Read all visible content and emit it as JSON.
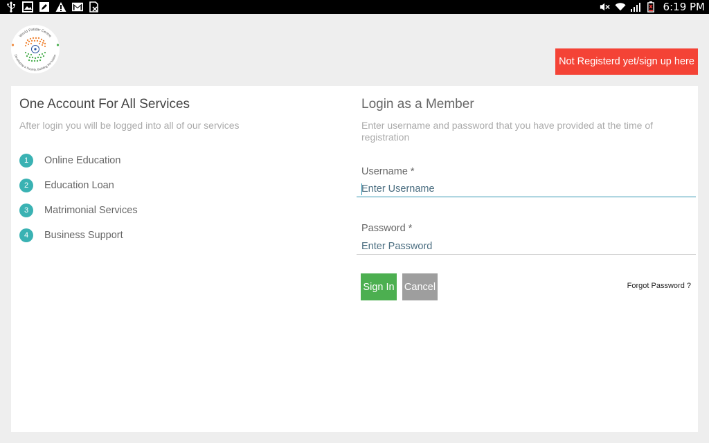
{
  "status_bar": {
    "time": "6:19 PM",
    "left_icons": [
      "usb-icon",
      "image-notification-icon",
      "edit-notification-icon",
      "warning-icon",
      "gmail-icon",
      "no-sim-icon"
    ],
    "right_icons": [
      "mute-icon",
      "wifi-icon",
      "signal-icon",
      "battery-low-icon"
    ]
  },
  "header": {
    "logo_text_top": "World Patidar Centre",
    "logo_text_bottom": "Developing a Society, Building the Nation",
    "signup_label": "Not Registerd yet/sign up here"
  },
  "left": {
    "title": "One Account For All Services",
    "subtitle": "After login you will be logged into all of our services",
    "services": [
      {
        "num": "1",
        "label": "Online Education"
      },
      {
        "num": "2",
        "label": "Education Loan"
      },
      {
        "num": "3",
        "label": "Matrimonial Services"
      },
      {
        "num": "4",
        "label": "Business Support"
      }
    ]
  },
  "login": {
    "title": "Login as a Member",
    "subtitle": "Enter username and password that you have provided at the time of registration",
    "username_label": "Username  *",
    "username_placeholder": "Enter Username",
    "username_value": "",
    "password_label": "Password  *",
    "password_placeholder": "Enter Password",
    "password_value": "",
    "signin_label": "Sign In",
    "cancel_label": "Cancel",
    "forgot_label": "Forgot Password ?"
  },
  "colors": {
    "accent_teal": "#3ab2b3",
    "signup_red": "#f44336",
    "signin_green": "#4caf50",
    "cancel_gray": "#9e9e9e",
    "focus_blue": "#2f93b0"
  }
}
